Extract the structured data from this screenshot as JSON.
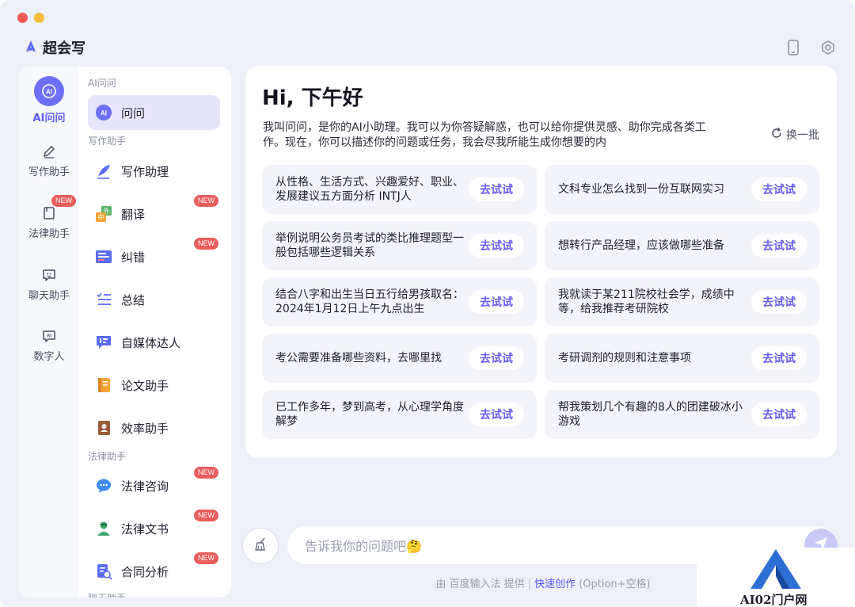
{
  "app": {
    "title": "超会写"
  },
  "rail": {
    "items": [
      {
        "label": "AI问问",
        "icon": "ai-chat-icon",
        "active": true
      },
      {
        "label": "写作助手",
        "icon": "pen-icon"
      },
      {
        "label": "法律助手",
        "icon": "book-icon",
        "badge": "NEW"
      },
      {
        "label": "聊天助手",
        "icon": "chat-face-icon"
      },
      {
        "label": "数字人",
        "icon": "ai-bubble-icon"
      }
    ]
  },
  "subnav": {
    "sections": [
      {
        "label": "AI问问"
      },
      {
        "label": "写作助手"
      },
      {
        "label": "法律助手"
      },
      {
        "label": "聊天助手"
      }
    ],
    "items": [
      {
        "label": "问问",
        "active": true
      },
      {
        "label": "写作助理"
      },
      {
        "label": "翻译",
        "badge": "NEW"
      },
      {
        "label": "纠错",
        "badge": "NEW"
      },
      {
        "label": "总结"
      },
      {
        "label": "自媒体达人"
      },
      {
        "label": "论文助手"
      },
      {
        "label": "效率助手"
      },
      {
        "label": "法律咨询",
        "badge": "NEW"
      },
      {
        "label": "法律文书",
        "badge": "NEW"
      },
      {
        "label": "合同分析",
        "badge": "NEW"
      }
    ]
  },
  "main": {
    "greeting": "Hi, 下午好",
    "intro": "我叫问问，是你的AI小助理。我可以为你答疑解惑，也可以给你提供灵感、助你完成各类工作。现在，你可以描述你的问题或任务，我会尽我所能生成你想要的内",
    "refresh_label": "换一批",
    "try_label": "去试试",
    "cards": [
      "从性格、生活方式、兴趣爱好、职业、发展建议五方面分析 INTJ人",
      "文科专业怎么找到一份互联网实习",
      "举例说明公务员考试的类比推理题型一般包括哪些逻辑关系",
      "想转行产品经理，应该做哪些准备",
      "结合八字和出生当日五行给男孩取名：2024年1月12日上午九点出生",
      "我就读于某211院校社会学，成绩中等，给我推荐考研院校",
      "考公需要准备哪些资料，去哪里找",
      "考研调剂的规则和注意事项",
      "已工作多年，梦到高考，从心理学角度解梦",
      "帮我策划几个有趣的8人的团建破冰小游戏"
    ]
  },
  "input": {
    "placeholder": "告诉我你的问题吧🤔"
  },
  "footer": {
    "prefix": "由 百度输入法 提供",
    "link": "快速创作",
    "shortcut": "(Option+空格)"
  },
  "watermark": {
    "text": "AI02门户网"
  }
}
